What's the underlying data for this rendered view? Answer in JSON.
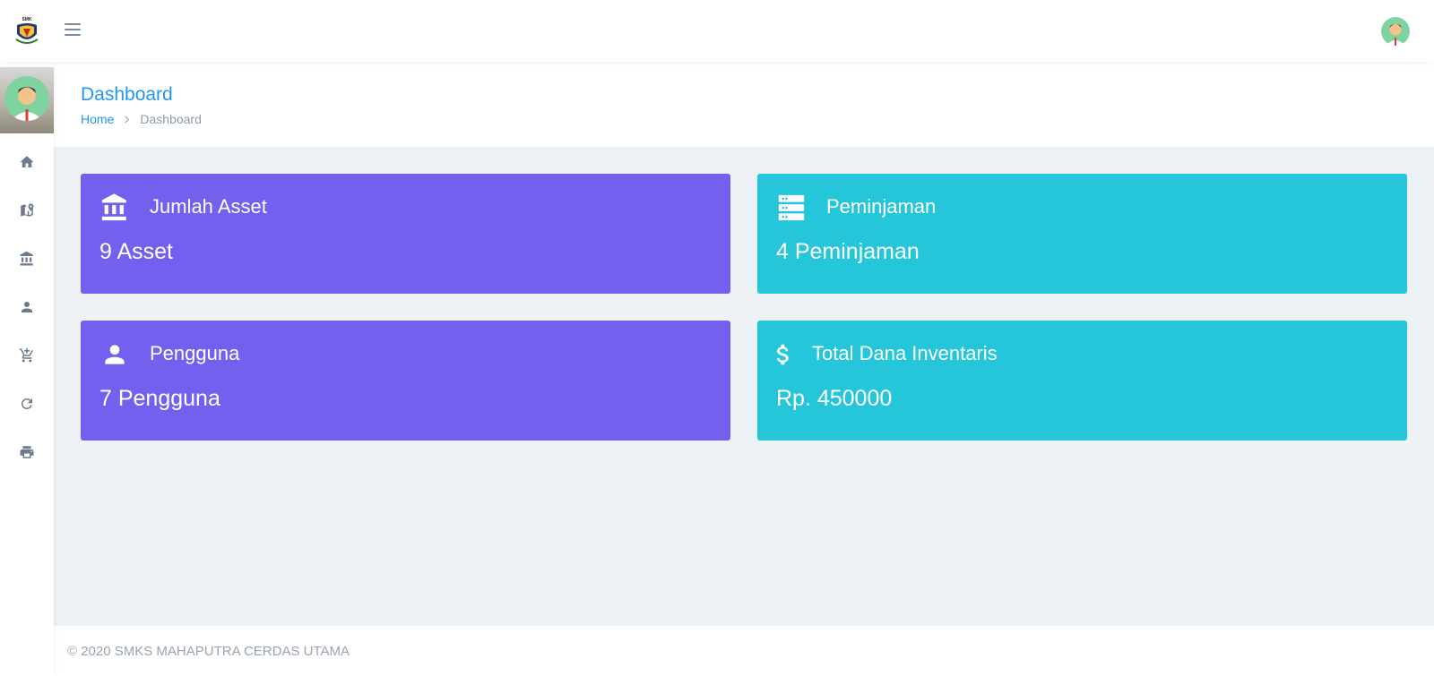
{
  "topbar": {
    "logo_text": "SMK",
    "menu_icon": "hamburger-menu-icon",
    "avatar_icon": "user-avatar-icon"
  },
  "sidebar": {
    "items": [
      {
        "icon": "home-icon"
      },
      {
        "icon": "map-marker-icon"
      },
      {
        "icon": "bank-icon"
      },
      {
        "icon": "user-icon"
      },
      {
        "icon": "cart-add-icon"
      },
      {
        "icon": "refresh-icon"
      },
      {
        "icon": "printer-icon"
      }
    ]
  },
  "header": {
    "title": "Dashboard",
    "breadcrumb_home": "Home",
    "breadcrumb_current": "Dashboard"
  },
  "cards": [
    {
      "title": "Jumlah Asset",
      "value": "9 Asset",
      "icon": "bank-icon",
      "color": "#7460ee"
    },
    {
      "title": "Peminjaman",
      "value": "4 Peminjaman",
      "icon": "server-icon",
      "color": "#26c6da"
    },
    {
      "title": "Pengguna",
      "value": "7 Pengguna",
      "icon": "user-icon",
      "color": "#7460ee"
    },
    {
      "title": "Total Dana Inventaris",
      "value": "Rp. 450000",
      "icon": "dollar-icon",
      "color": "#26c6da"
    }
  ],
  "footer": {
    "text": "© 2020 SMKS MAHAPUTRA CERDAS UTAMA"
  },
  "colors": {
    "accent": "#2196f3",
    "purple": "#7460ee",
    "cyan": "#26c6da",
    "background": "#edf2f6"
  }
}
